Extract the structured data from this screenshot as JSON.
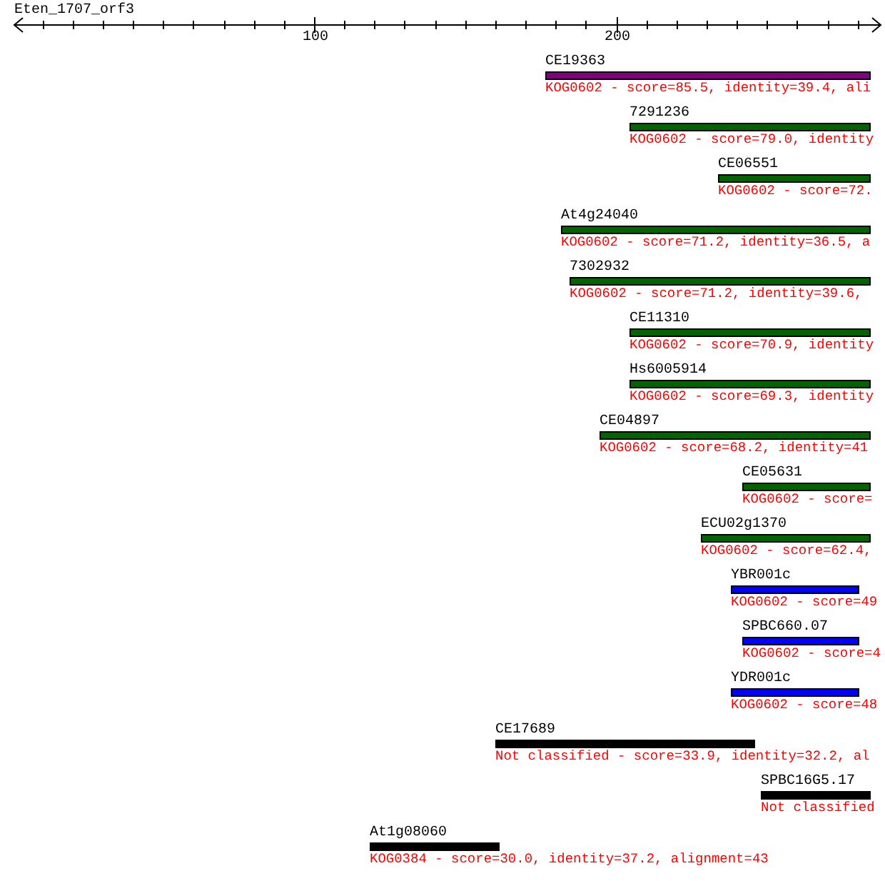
{
  "title": "Eten_1707_orf3",
  "axis": {
    "labels": [
      "100",
      "200"
    ]
  },
  "hits": [
    {
      "name": "CE19363",
      "color": "#800080",
      "description": "KOG0602 - score=85.5, identity=39.4, ali"
    },
    {
      "name": "7291236",
      "color": "#006400",
      "description": "KOG0602 - score=79.0, identity"
    },
    {
      "name": "CE06551",
      "color": "#006400",
      "description": "KOG0602 - score=72."
    },
    {
      "name": "At4g24040",
      "color": "#006400",
      "description": "KOG0602 - score=71.2, identity=36.5, a"
    },
    {
      "name": "7302932",
      "color": "#006400",
      "description": "KOG0602 - score=71.2, identity=39.6,"
    },
    {
      "name": "CE11310",
      "color": "#006400",
      "description": "KOG0602 - score=70.9, identity"
    },
    {
      "name": "Hs6005914",
      "color": "#006400",
      "description": "KOG0602 - score=69.3, identity"
    },
    {
      "name": "CE04897",
      "color": "#006400",
      "description": "KOG0602 - score=68.2, identity=41"
    },
    {
      "name": "CE05631",
      "color": "#006400",
      "description": "KOG0602 - score="
    },
    {
      "name": "ECU02g1370",
      "color": "#006400",
      "description": "KOG0602 - score=62.4,"
    },
    {
      "name": "YBR001c",
      "color": "#0000ff",
      "description": "KOG0602 - score=49"
    },
    {
      "name": "SPBC660.07",
      "color": "#0000ff",
      "description": "KOG0602 - score=4"
    },
    {
      "name": "YDR001c",
      "color": "#0000ff",
      "description": "KOG0602 - score=48"
    },
    {
      "name": "CE17689",
      "color": "#000000",
      "description": "Not classified - score=33.9, identity=32.2, al"
    },
    {
      "name": "SPBC16G5.17",
      "color": "#000000",
      "description": "Not classified"
    },
    {
      "name": "At1g08060",
      "color": "#000000",
      "description": "KOG0384 - score=30.0, identity=37.2, alignment=43"
    }
  ]
}
